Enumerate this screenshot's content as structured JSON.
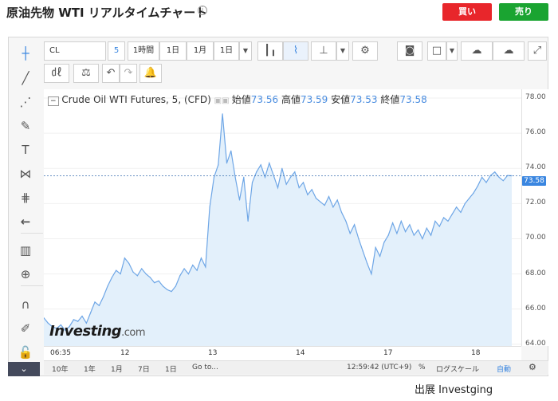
{
  "header": {
    "title": "原油先物 WTI リアルタイムチャート",
    "sell_label": "買い",
    "buy_label": "売り",
    "sell_color": "#e8262b",
    "buy_color": "#1aa431"
  },
  "toolbar": {
    "symbol": "CL",
    "interval_badge": "5",
    "intervals": [
      "1時間",
      "1日",
      "1月",
      "1日"
    ]
  },
  "legend": {
    "instrument": "Crude Oil WTI Futures, 5, (CFD)",
    "open_label": "始値",
    "open": "73.56",
    "high_label": "高値",
    "high": "73.59",
    "low_label": "安値",
    "low": "73.53",
    "close_label": "終値",
    "close": "73.58"
  },
  "bottom_bar": {
    "ranges": [
      "10年",
      "1年",
      "1月",
      "7日",
      "1日"
    ],
    "goto_label": "Go to...",
    "time": "12:59:42 (UTC+9)",
    "percent": "%",
    "log_scale": "ログスケール",
    "auto": "自動"
  },
  "watermark": {
    "brand": "Investing",
    "suffix": ".com"
  },
  "credit": "出展 Investging",
  "chart_data": {
    "type": "area",
    "x_ticks": [
      "06:35",
      "12",
      "13",
      "14",
      "17",
      "18"
    ],
    "y_ticks": [
      "78.00",
      "76.00",
      "74.00",
      "72.00",
      "70.00",
      "68.00",
      "66.00",
      "64.00"
    ],
    "ylim": [
      63.9,
      78.5
    ],
    "current_price": "73.58",
    "line_color": "#6ea6e6",
    "fill_color": "#e3f0fb",
    "values": [
      65.5,
      65.2,
      65.0,
      64.9,
      65.1,
      64.8,
      65.0,
      65.4,
      65.3,
      65.6,
      65.2,
      65.8,
      66.4,
      66.2,
      66.7,
      67.3,
      67.8,
      68.2,
      68.0,
      68.9,
      68.6,
      68.1,
      67.9,
      68.3,
      68.0,
      67.8,
      67.5,
      67.6,
      67.3,
      67.1,
      67.0,
      67.3,
      67.9,
      68.3,
      68.0,
      68.5,
      68.2,
      68.9,
      68.4,
      71.8,
      73.5,
      74.2,
      77.1,
      74.3,
      75.0,
      73.5,
      72.2,
      73.5,
      71.0,
      73.2,
      73.8,
      74.2,
      73.5,
      74.3,
      73.6,
      72.9,
      74.0,
      73.1,
      73.5,
      73.8,
      72.9,
      73.2,
      72.5,
      72.8,
      72.3,
      72.1,
      71.9,
      72.4,
      71.8,
      72.2,
      71.5,
      71.0,
      70.3,
      70.8,
      70.0,
      69.3,
      68.6,
      68.0,
      69.5,
      69.0,
      69.8,
      70.2,
      70.9,
      70.3,
      71.0,
      70.4,
      70.8,
      70.2,
      70.5,
      70.0,
      70.6,
      70.2,
      71.0,
      70.7,
      71.2,
      71.0,
      71.4,
      71.8,
      71.5,
      72.0,
      72.3,
      72.6,
      73.0,
      73.5,
      73.2,
      73.6,
      73.8,
      73.5,
      73.3,
      73.6,
      73.58
    ]
  }
}
